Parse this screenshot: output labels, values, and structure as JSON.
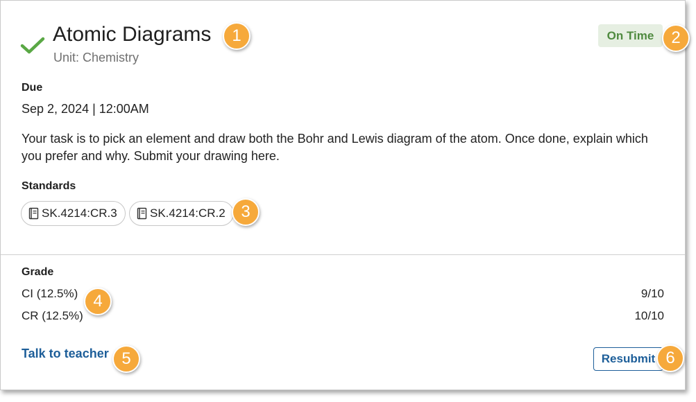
{
  "assignment": {
    "title": "Atomic Diagrams",
    "unit": "Unit: Chemistry",
    "status": "On Time",
    "due_label": "Due",
    "due_value": "Sep 2, 2024 | 12:00AM",
    "description": "Your task is to pick an element and draw both the Bohr and Lewis diagram of the atom. Once done, explain which you prefer and why. Submit your drawing here."
  },
  "standards": {
    "label": "Standards",
    "items": [
      {
        "code": "SK.4214:CR.3",
        "icon": "book-icon"
      },
      {
        "code": "SK.4214:CR.2",
        "icon": "book-icon"
      }
    ]
  },
  "grade": {
    "label": "Grade",
    "rows": [
      {
        "name": "CI (12.5%)",
        "score": "9/10"
      },
      {
        "name": "CR (12.5%)",
        "score": "10/10"
      }
    ]
  },
  "actions": {
    "talk_label": "Talk to teacher",
    "resubmit_label": "Resubmit"
  },
  "callouts": [
    "1",
    "2",
    "3",
    "4",
    "5",
    "6"
  ],
  "colors": {
    "accent": "#1d5e99",
    "success": "#5aa845",
    "status_bg": "#e6efe2",
    "status_text": "#4f8a3f",
    "callout": "#f6a93b"
  }
}
